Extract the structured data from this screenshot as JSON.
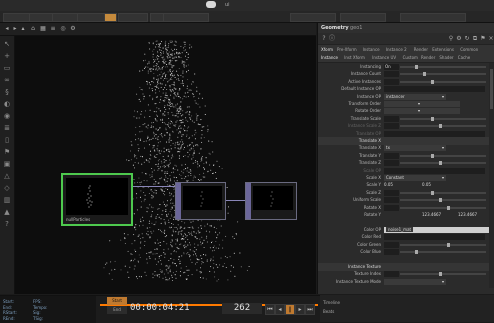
{
  "window": {
    "title": "ui"
  },
  "menubar": {
    "items": [
      "",
      "",
      "",
      "",
      "",
      "",
      "",
      ""
    ],
    "active_index": 4
  },
  "parameters": {
    "op_type": "Geometry",
    "op_name": "geo1",
    "tabs_row1": [
      "Xform",
      "Pre-Xform",
      "Instance",
      "Instance 2",
      "Render",
      "Extensions",
      "Common"
    ],
    "tabs_row2": [
      "Instance",
      "Inst Xform",
      "Instance UV",
      "Custom",
      "Render",
      "Shader",
      "Cache"
    ],
    "rows": [
      {
        "label": "Instancing",
        "value": "On",
        "kind": "toggle"
      },
      {
        "label": "Instance Count",
        "value": "",
        "kind": "slider"
      },
      {
        "label": "Active Instances",
        "value": "",
        "kind": "slider"
      },
      {
        "label": "Default Instance OP",
        "value": "",
        "kind": "text"
      },
      {
        "label": "Instance OP",
        "value": "instancer",
        "kind": "dropdown"
      },
      {
        "label": "Transform Order",
        "value": "",
        "kind": "dropdown3"
      },
      {
        "label": "Rotate Order",
        "value": "",
        "kind": "dropdown3"
      },
      {
        "label": "Translate Scale",
        "value": "",
        "kind": "slider"
      },
      {
        "label": "Instance Scale Z",
        "value": "",
        "kind": "slider",
        "dim": true
      },
      {
        "label": "Translate OP",
        "value": "",
        "kind": "text",
        "dim": true
      },
      {
        "label": "Translate X",
        "value": "",
        "kind": "sec"
      },
      {
        "label": "Translate X",
        "value": "tx",
        "kind": "dropdown"
      },
      {
        "label": "Translate Y",
        "value": "",
        "kind": "slider"
      },
      {
        "label": "Translate Z",
        "value": "",
        "kind": "slider"
      },
      {
        "label": "Scale OP",
        "value": "",
        "kind": "text",
        "dim": true
      },
      {
        "label": "Scale X",
        "value": "Constant",
        "kind": "dropdown"
      },
      {
        "label": "Scale Y",
        "value": "",
        "kind": "triple",
        "v1": "0.05",
        "v2": "0.05",
        "v3": ""
      },
      {
        "label": "Scale Z",
        "value": "",
        "kind": "slider"
      },
      {
        "label": "Uniform Scale",
        "value": "",
        "kind": "slider"
      },
      {
        "label": "Rotate X",
        "value": "",
        "kind": "slider"
      },
      {
        "label": "Rotate Y",
        "value": "",
        "kind": "triple",
        "v1": "",
        "v2": "123.4667",
        "v3": "123.4667"
      },
      {
        "label": "",
        "value": "",
        "kind": "gap"
      },
      {
        "label": "Color OP",
        "value": "noise1_mat",
        "kind": "textsel"
      },
      {
        "label": "Color Red",
        "value": "",
        "kind": "text"
      },
      {
        "label": "Color Green",
        "value": "",
        "kind": "slider"
      },
      {
        "label": "Color Blue",
        "value": "",
        "kind": "slider"
      },
      {
        "label": "",
        "value": "",
        "kind": "gap"
      },
      {
        "label": "Instance Texture",
        "value": "",
        "kind": "sec"
      },
      {
        "label": "Texture Index",
        "value": "",
        "kind": "slider"
      },
      {
        "label": "Instance Texture Mode",
        "value": "",
        "kind": "dropdown"
      }
    ]
  },
  "network": {
    "nodes": [
      {
        "label": "nullParticles",
        "selected": true
      },
      {
        "label": "",
        "selected": false
      },
      {
        "label": "",
        "selected": false
      }
    ]
  },
  "timeline": {
    "start_label": "Start",
    "end_label": "End",
    "timecode": "00:00:04:21",
    "frame": "262"
  },
  "stats": {
    "col1": [
      "Start:",
      "End:",
      "RStart:",
      "REnd:"
    ],
    "col2": [
      "FPS:",
      "Tempo:",
      "Sig:",
      "TSig:"
    ],
    "col3": [
      "",
      "",
      "",
      ""
    ]
  },
  "right_bottom": {
    "label1": "Timeline",
    "label2": "Beats"
  },
  "colors": {
    "accent": "#c07a30",
    "selected_node": "#4ec94e",
    "wire": "#8a86b8"
  }
}
